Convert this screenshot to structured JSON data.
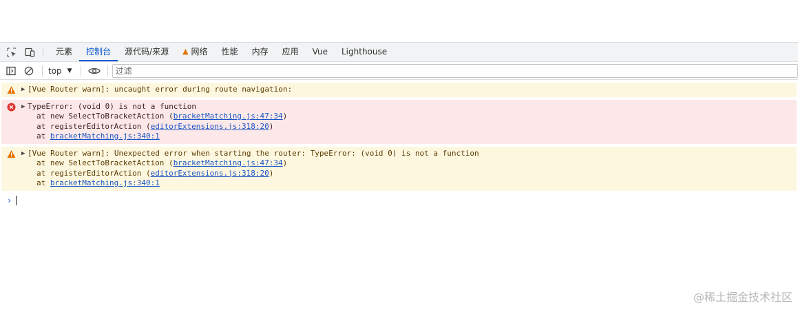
{
  "tabs": [
    {
      "label": "元素",
      "active": false,
      "warning": false
    },
    {
      "label": "控制台",
      "active": true,
      "warning": false
    },
    {
      "label": "源代码/来源",
      "active": false,
      "warning": false
    },
    {
      "label": "网络",
      "active": false,
      "warning": true
    },
    {
      "label": "性能",
      "active": false,
      "warning": false
    },
    {
      "label": "内存",
      "active": false,
      "warning": false
    },
    {
      "label": "应用",
      "active": false,
      "warning": false
    },
    {
      "label": "Vue",
      "active": false,
      "warning": false
    },
    {
      "label": "Lighthouse",
      "active": false,
      "warning": false
    }
  ],
  "toolbar": {
    "context": "top",
    "filter_placeholder": "过滤"
  },
  "messages": [
    {
      "level": "warning",
      "lines": [
        {
          "text": "[Vue Router warn]: uncaught error during route navigation:"
        }
      ]
    },
    {
      "level": "error",
      "lines": [
        {
          "text": "TypeError: (void 0) is not a function"
        },
        {
          "prefix": "at new SelectToBracketAction (",
          "link": "bracketMatching.js:47:34",
          "suffix": ")"
        },
        {
          "prefix": "at registerEditorAction (",
          "link": "editorExtensions.js:318:20",
          "suffix": ")"
        },
        {
          "prefix": "at ",
          "link": "bracketMatching.js:340:1",
          "suffix": ""
        }
      ]
    },
    {
      "level": "warning",
      "lines": [
        {
          "text": "[Vue Router warn]: Unexpected error when starting the router: TypeError: (void 0) is not a function"
        },
        {
          "prefix": "at new SelectToBracketAction (",
          "link": "bracketMatching.js:47:34",
          "suffix": ")"
        },
        {
          "prefix": "at registerEditorAction (",
          "link": "editorExtensions.js:318:20",
          "suffix": ")"
        },
        {
          "prefix": "at ",
          "link": "bracketMatching.js:340:1",
          "suffix": ""
        }
      ]
    }
  ],
  "watermark": "@稀土掘金技术社区",
  "colors": {
    "accent": "#0b57d0",
    "warning_bg": "#fef7e0",
    "error_bg": "#fce8e8",
    "link": "#1a55c7",
    "warning_icon": "#e37400",
    "error_icon": "#dc362e"
  }
}
